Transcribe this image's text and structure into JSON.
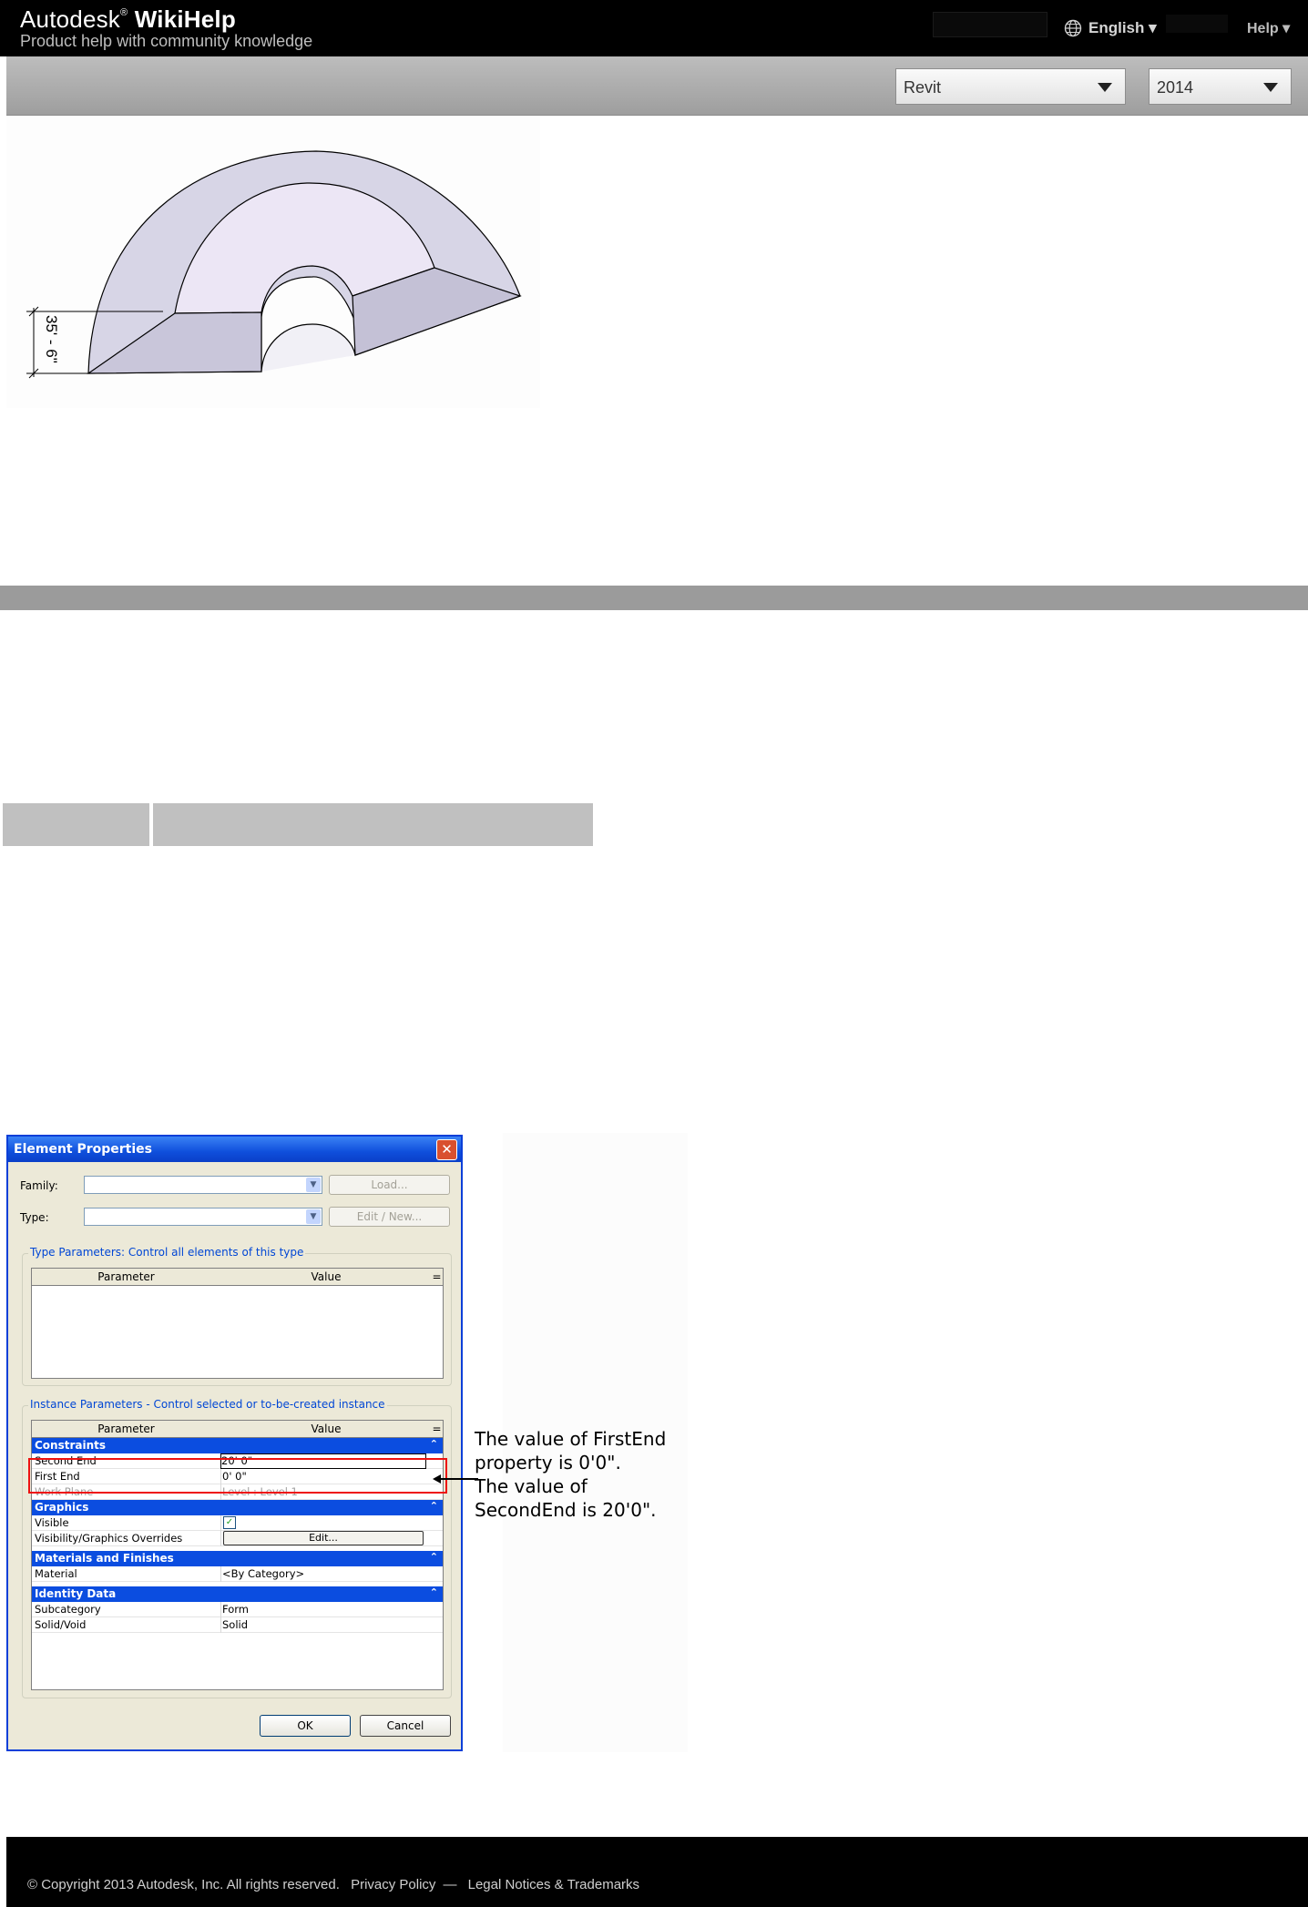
{
  "header": {
    "brand_prefix": "Autodesk",
    "brand_mark": "®",
    "brand_name": "WikiHelp",
    "tagline": "Product help with community knowledge",
    "language": "English ▾",
    "help": "Help ▾"
  },
  "toolbar": {
    "product": "Revit",
    "year": "2014"
  },
  "figure": {
    "dimension_label": "35' - 6\""
  },
  "dialog": {
    "title": "Element Properties",
    "close": "✕",
    "family_label": "Family:",
    "type_label": "Type:",
    "load_button": "Load...",
    "edit_new_button": "Edit / New...",
    "type_params_title": "Type Parameters: Control all elements of this type",
    "instance_params_title": "Instance Parameters - Control selected or to-be-created instance",
    "col_parameter": "Parameter",
    "col_value": "Value",
    "col_eq": "=",
    "sections": {
      "constraints": "Constraints",
      "graphics": "Graphics",
      "materials": "Materials and Finishes",
      "identity": "Identity Data"
    },
    "rows": {
      "second_end": {
        "k": "Second End",
        "v": "20'  0\""
      },
      "first_end": {
        "k": "First End",
        "v": "0'  0\""
      },
      "work_plane": {
        "k": "Work Plane",
        "v": "Level : Level 1"
      },
      "visible": {
        "k": "Visible",
        "v": "✓"
      },
      "vg_overrides": {
        "k": "Visibility/Graphics Overrides",
        "v": "Edit..."
      },
      "material": {
        "k": "Material",
        "v": "<By Category>"
      },
      "subcategory": {
        "k": "Subcategory",
        "v": "Form"
      },
      "solid_void": {
        "k": "Solid/Void",
        "v": "Solid"
      }
    },
    "ok": "OK",
    "cancel": "Cancel",
    "collapse": "⌃"
  },
  "callout": {
    "line1": "The value of FirstEnd",
    "line2": "property is 0'0\".",
    "line3": "The value of",
    "line4": "SecondEnd is 20'0\"."
  },
  "footer": {
    "copyright": "© Copyright 2013 Autodesk, Inc. All rights reserved.",
    "privacy": "Privacy Policy",
    "sep": "—",
    "legal": "Legal Notices & Trademarks"
  }
}
